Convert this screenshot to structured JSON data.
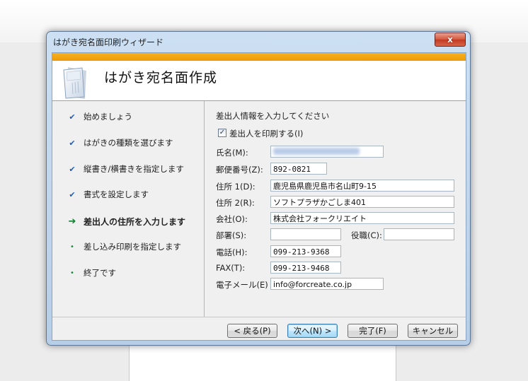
{
  "window": {
    "title": "はがき宛名面印刷ウィザード",
    "close_label": "x"
  },
  "header": {
    "title": "はがき宛名面作成",
    "icon": "document-icon"
  },
  "steps": [
    {
      "label": "始めましょう",
      "state": "done"
    },
    {
      "label": "はがきの種類を選びます",
      "state": "done"
    },
    {
      "label": "縦書き/横書きを指定します",
      "state": "done"
    },
    {
      "label": "書式を設定します",
      "state": "done"
    },
    {
      "label": "差出人の住所を入力します",
      "state": "current"
    },
    {
      "label": "差し込み印刷を指定します",
      "state": "pending"
    },
    {
      "label": "終了です",
      "state": "pending"
    }
  ],
  "step_marks": {
    "done": "✔",
    "current": "➔",
    "pending": "•"
  },
  "form": {
    "instruction": "差出人情報を入力してください",
    "print_sender_label": "差出人を印刷する(I)",
    "print_sender_checked": true,
    "check_mark": "✓",
    "fields": {
      "name": {
        "label": "氏名(M):",
        "value": ""
      },
      "postal": {
        "label": "郵便番号(Z):",
        "value": "892-0821"
      },
      "address1": {
        "label": "住所 1(D):",
        "value": "鹿児島県鹿児島市名山町9-15"
      },
      "address2": {
        "label": "住所 2(R):",
        "value": "ソフトプラザかごしま401"
      },
      "company": {
        "label": "会社(O):",
        "value": "株式会社フォークリエイト"
      },
      "department": {
        "label": "部署(S):",
        "value": ""
      },
      "title": {
        "label": "役職(C):",
        "value": ""
      },
      "phone": {
        "label": "電話(H):",
        "value": "099-213-9368"
      },
      "fax": {
        "label": "FAX(T):",
        "value": "099-213-9468"
      },
      "email": {
        "label": "電子メール(E)",
        "value": "info@forcreate.co.jp"
      }
    }
  },
  "buttons": {
    "back": "< 戻る(P)",
    "next": "次へ(N) >",
    "finish": "完了(F)",
    "cancel": "キャンセル"
  },
  "colors": {
    "accent_stripe": "#f3a80f",
    "titlebar": "#c4d9ef",
    "check": "#1c5fbf",
    "current_arrow": "#0b7d2c"
  }
}
